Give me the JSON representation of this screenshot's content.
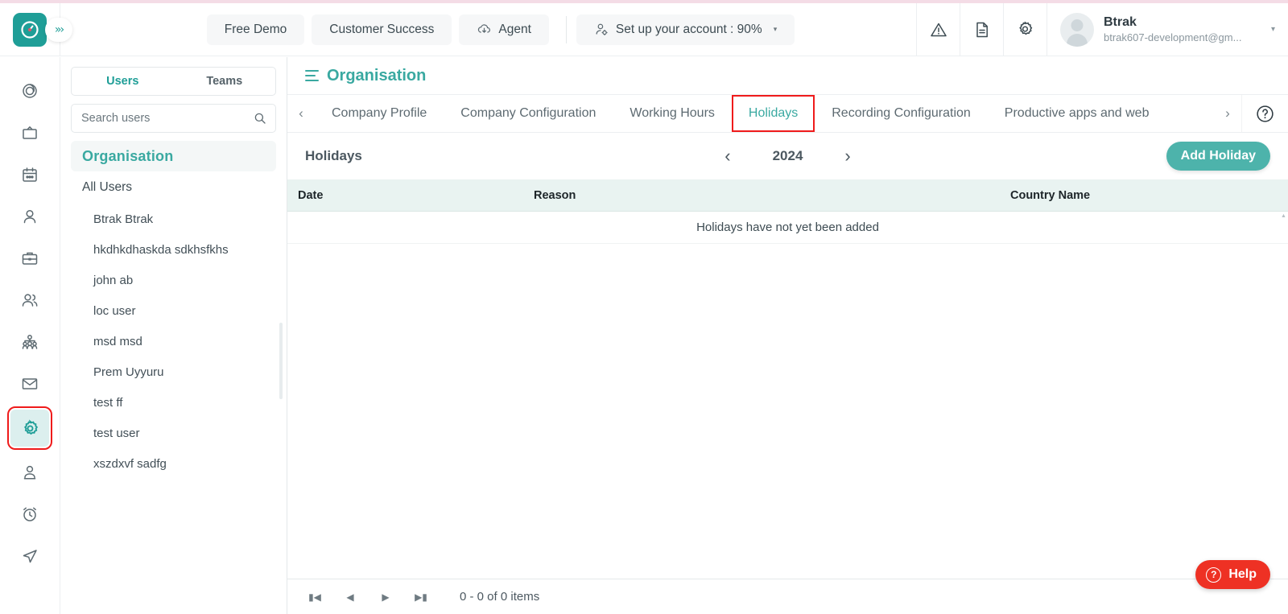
{
  "topbar": {
    "logo_icon": "clock-logo-icon",
    "expand_icon": "double-chevron-right-icon",
    "chips": [
      {
        "label": "Free Demo",
        "icon": null,
        "name": "free-demo-button"
      },
      {
        "label": "Customer Success",
        "icon": null,
        "name": "customer-success-button"
      },
      {
        "label": "Agent",
        "icon": "cloud-download-icon",
        "name": "agent-button"
      }
    ],
    "account_setup": {
      "label": "Set up your account : 90%",
      "icon": "user-gear-icon",
      "caret": "▾"
    },
    "icons": [
      {
        "name": "warning-icon",
        "glyph": "warning-triangle"
      },
      {
        "name": "document-icon",
        "glyph": "document"
      },
      {
        "name": "settings-gear-icon",
        "glyph": "gear"
      }
    ],
    "user": {
      "name": "Btrak",
      "email": "btrak607-development@gm...",
      "caret": "▾"
    }
  },
  "rail": {
    "items": [
      {
        "name": "sidebar-icon-dashboard",
        "glyph": "spiral"
      },
      {
        "name": "sidebar-icon-screenshots",
        "glyph": "tv"
      },
      {
        "name": "sidebar-icon-calendar",
        "glyph": "calendar"
      },
      {
        "name": "sidebar-icon-user",
        "glyph": "user"
      },
      {
        "name": "sidebar-icon-projects",
        "glyph": "briefcase"
      },
      {
        "name": "sidebar-icon-teams",
        "glyph": "users"
      },
      {
        "name": "sidebar-icon-org-chart",
        "glyph": "org"
      },
      {
        "name": "sidebar-icon-mail",
        "glyph": "mail"
      },
      {
        "name": "sidebar-icon-settings",
        "glyph": "gear",
        "active": true
      },
      {
        "name": "sidebar-icon-profile",
        "glyph": "profile"
      },
      {
        "name": "sidebar-icon-alarm",
        "glyph": "alarm"
      },
      {
        "name": "sidebar-icon-send",
        "glyph": "send"
      }
    ]
  },
  "users_panel": {
    "tabs": [
      {
        "label": "Users",
        "selected": true
      },
      {
        "label": "Teams",
        "selected": false
      }
    ],
    "search": {
      "placeholder": "Search users",
      "value": "",
      "icon": "search-icon"
    },
    "org_label": "Organisation",
    "all_users_label": "All Users",
    "users": [
      "Btrak Btrak",
      "hkdhkdhaskda sdkhsfkhs",
      "john ab",
      "loc user",
      "msd msd",
      "Prem Uyyuru",
      "test ff",
      "test user",
      "xszdxvf sadfg"
    ]
  },
  "main": {
    "title": "Organisation",
    "menu_icon": "hamburger-icon",
    "tabs": [
      {
        "label": "Company Profile",
        "active": false
      },
      {
        "label": "Company Configuration",
        "active": false
      },
      {
        "label": "Working Hours",
        "active": false
      },
      {
        "label": "Holidays",
        "active": true
      },
      {
        "label": "Recording Configuration",
        "active": false
      },
      {
        "label": "Productive apps and web",
        "active": false
      }
    ],
    "tab_prev_icon": "chevron-left-icon",
    "tab_next_icon": "chevron-right-icon",
    "help_circle_icon": "question-circle-icon",
    "panel": {
      "title": "Holidays",
      "year": "2024",
      "prev_year_icon": "chevron-left-icon",
      "next_year_icon": "chevron-right-icon",
      "add_button": "Add Holiday"
    },
    "table": {
      "columns": [
        "Date",
        "Reason",
        "Country Name"
      ],
      "rows": [],
      "empty_message": "Holidays have not yet been added"
    },
    "pager": {
      "first_icon": "first-page-icon",
      "prev_icon": "prev-page-icon",
      "next_icon": "next-page-icon",
      "last_icon": "last-page-icon",
      "info": "0 - 0 of 0 items"
    }
  },
  "help_widget": {
    "label": "Help",
    "icon": "question-mark-icon"
  },
  "colors": {
    "accent_teal": "#3aa9a1",
    "logo_teal": "#1f9e97",
    "button_teal": "#4db3ab",
    "table_header": "#e9f3f1",
    "highlight_red": "#ef1b1b",
    "help_red": "#ee3124",
    "top_strip_pink": "#f4dce6"
  }
}
